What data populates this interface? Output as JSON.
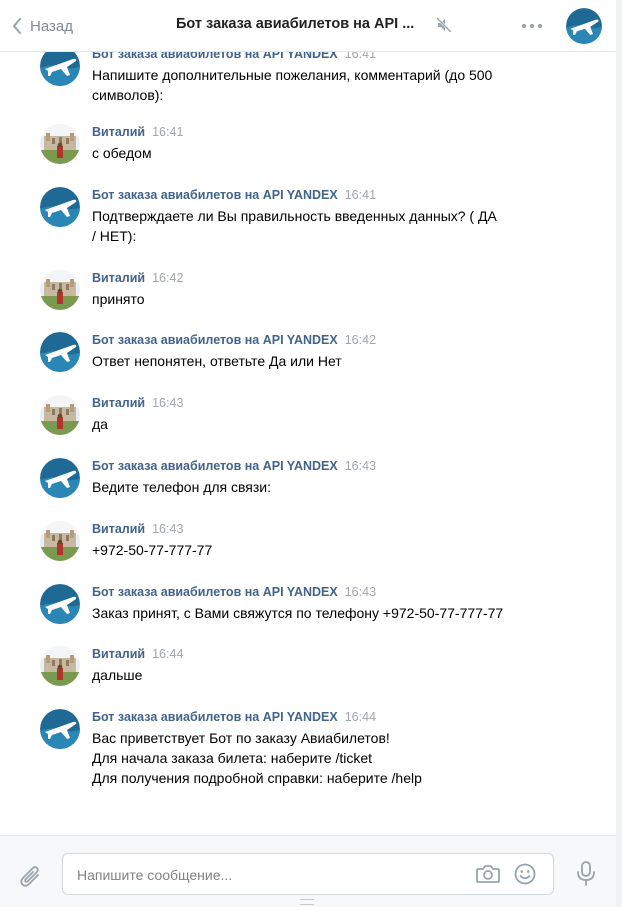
{
  "header": {
    "back_label": "Назад",
    "title": "Бот заказа авиабилетов на API ..."
  },
  "messages": [
    {
      "author": "Бот заказа авиабилетов на API YANDEX",
      "time": "16:41",
      "kind": "bot",
      "text": "Напишите дополнительные пожелания, комментарий (до 500\nсимволов):"
    },
    {
      "author": "Виталий",
      "time": "16:41",
      "kind": "user",
      "text": "с обедом"
    },
    {
      "author": "Бот заказа авиабилетов на API YANDEX",
      "time": "16:41",
      "kind": "bot",
      "text": "Подтверждаете ли Вы правильность введенных данных? ( ДА\n/ НЕТ):"
    },
    {
      "author": "Виталий",
      "time": "16:42",
      "kind": "user",
      "text": "принято"
    },
    {
      "author": "Бот заказа авиабилетов на API YANDEX",
      "time": "16:42",
      "kind": "bot",
      "text": "Ответ непонятен, ответьте Да или Нет"
    },
    {
      "author": "Виталий",
      "time": "16:43",
      "kind": "user",
      "text": "да"
    },
    {
      "author": "Бот заказа авиабилетов на API YANDEX",
      "time": "16:43",
      "kind": "bot",
      "text": "Ведите телефон для связи:"
    },
    {
      "author": "Виталий",
      "time": "16:43",
      "kind": "user",
      "text": "+972-50-77-777-77"
    },
    {
      "author": "Бот заказа авиабилетов на API YANDEX",
      "time": "16:43",
      "kind": "bot",
      "text": "Заказ принят, с Вами свяжутся по телефону +972-50-77-777-77"
    },
    {
      "author": "Виталий",
      "time": "16:44",
      "kind": "user",
      "text": "дальше"
    },
    {
      "author": "Бот заказа авиабилетов на API YANDEX",
      "time": "16:44",
      "kind": "bot",
      "text": "Вас приветствует Бот по заказу Авиабилетов!\nДля начала заказа билета: наберите /ticket\nДля получения подробной справки: наберите /help"
    }
  ],
  "composer": {
    "placeholder": "Напишите сообщение..."
  },
  "icons": {
    "back": "chevron-left-icon",
    "mute": "muted-speaker-icon",
    "more": "more-dots-icon",
    "attach": "paperclip-icon",
    "camera": "camera-icon",
    "emoji": "smile-icon",
    "mic": "microphone-icon"
  },
  "colors": {
    "author": "#42648b",
    "time": "#a0a6ae",
    "bot_avatar": "#1f6a94",
    "icon": "#99a2ad"
  }
}
